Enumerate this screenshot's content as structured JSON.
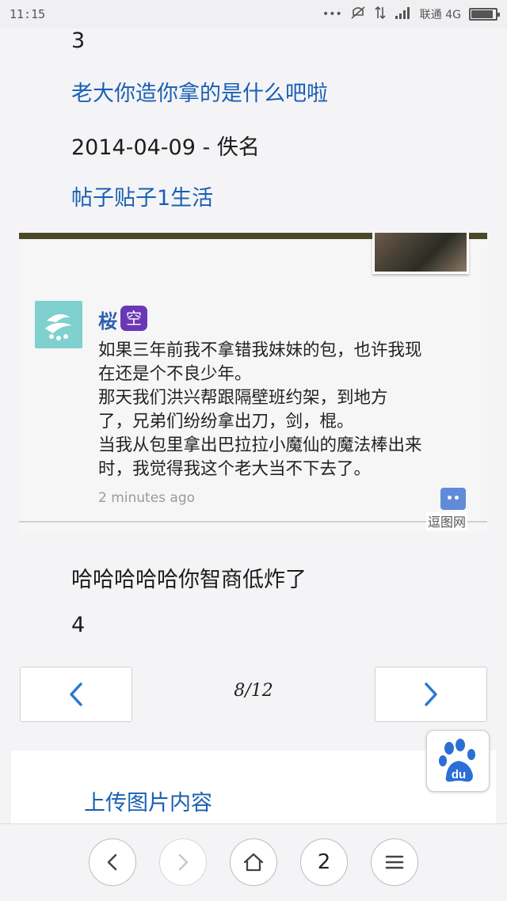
{
  "status_bar": {
    "time": "11:15",
    "carrier": "联通 4G",
    "battery_level": 0.9
  },
  "post": {
    "floor_top": "3",
    "line_link": "老大你造你拿的是什么吧啦",
    "date_author": "2014-04-09 - 佚名",
    "category": "帖子贴子1生活"
  },
  "image_card": {
    "username": "桜",
    "badge": "空",
    "text_lines": [
      "如果三年前我不拿错我妹妹的包，也许我现",
      "在还是个不良少年。",
      "那天我们洪兴帮跟隔壁班约架，到地方",
      "了，兄弟们纷纷拿出刀，剑，棍。",
      "当我从包里拿出巴拉拉小魔仙的魔法棒出来",
      "时，我觉得我这个老大当不下去了。"
    ],
    "time_ago": "2 minutes ago",
    "watermark": "逗图网"
  },
  "caption": "哈哈哈哈哈你智商低炸了",
  "floor_next": "4",
  "pagination": {
    "count": "8/12"
  },
  "upload_label": "上传图片内容",
  "bottom_nav": {
    "tab_count": "2"
  },
  "colors": {
    "link": "#1a5fb4",
    "pager_arrow": "#2a7ad2",
    "baidu_blue": "#2b6fd6"
  }
}
